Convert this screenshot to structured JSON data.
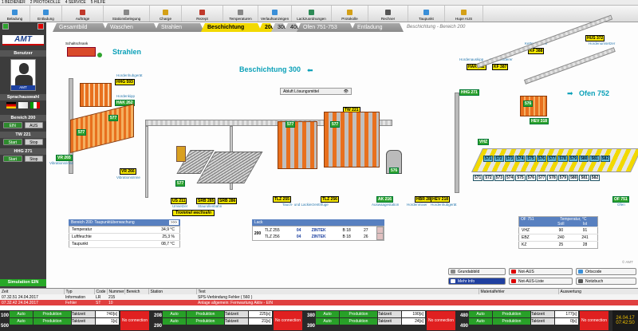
{
  "menu": [
    "1 BEDIENER",
    "2 PROTOKOLLE",
    "4 SERVICE",
    "5 HILFE"
  ],
  "toolbar": {
    "items": [
      "Beladung",
      "Entladung",
      "Aufträge",
      "Stationsbelegung",
      "Charge",
      "Rezept",
      "Temperaturen",
      "Verlaufsanzeigen",
      "Lackzuordnungen",
      "Protokolle",
      "Rechner",
      "Taupunkt",
      "Hupe AUS"
    ],
    "colors": [
      "#3a8fd8",
      "#3a8fd8",
      "#c0392b",
      "#888888",
      "#d4a017",
      "#c0392b",
      "#888888",
      "#3a8fd8",
      "#2e8b57",
      "#d4a017",
      "#555555",
      "#3a8fd8",
      "#d4a017"
    ]
  },
  "sidebar": {
    "logo": "AMT",
    "user_header": "Benutzer",
    "user_badge": "AMT",
    "lang_header": "Sprachauswahl",
    "bereich200": {
      "title": "Bereich 200",
      "ein": "EIN",
      "aus": "AUS"
    },
    "tw221": {
      "title": "TW 221",
      "start": "Start",
      "stop": "Stop"
    },
    "hhg271": {
      "title": "HHG 271",
      "start": "Start",
      "stop": "Stop"
    },
    "simulation": "Simulation EIN"
  },
  "tabs": [
    {
      "label": "Gesamtbild"
    },
    {
      "label": "Waschen"
    },
    {
      "label": "Strahlen"
    },
    {
      "label": "Beschichtung"
    },
    {
      "label": "200"
    },
    {
      "label": "300"
    },
    {
      "label": "400"
    },
    {
      "label": "Ofen 751-753"
    },
    {
      "label": "Entladung"
    },
    {
      "label": "Beschichtung - Bereich 200"
    }
  ],
  "plant": {
    "titles": {
      "strahlen": "Strahlen",
      "beschichtung": "Beschichtung 300",
      "ofen": "Ofen 752"
    },
    "labels": {
      "schaltschrank": "Schaltschrank",
      "hhg593": "HHG 593",
      "hak262": "HAK 262",
      "vr265": "VR 265",
      "vr266": "VR 266",
      "us211": "US 211",
      "srb285": "SRB 285",
      "srb286": "SRB 286",
      "tlz255": "TLZ 255",
      "tlz256": "TLZ 256",
      "tw221": "TW 221",
      "ak216": "AK 216",
      "hbr280": "HBR 280",
      "hev218": "HEV 218",
      "hus372": "HUS 372",
      "kf388": "KF 388",
      "hak362": "HAK 362",
      "kf387": "KF 387",
      "hhg271": "HHG 271",
      "hev318": "HEV 318",
      "of751": "OF 751",
      "vhz": "VHZ",
      "trommel": "Trommel wechseln"
    },
    "captions": {
      "hordenhubgeraet": "Hordenhubgerät",
      "hordenkipp": "Hordenkipp",
      "vibrationsrinne": "Vibrationsrinne",
      "umsetzer": "Umsetzer",
      "staurollenbahn": "Staurollenbahn",
      "tauch": "Tauch- und Lackierzentrifuge",
      "auswaage": "Auswaagestation",
      "hordenmixer": "Hordenmixer",
      "hordenhubgeraet2": "Hordenhubgerät",
      "kettenfoerderer": "Kettenförderer",
      "hordenauskipp": "Hordenauskipp",
      "hordenumsetzer": "Hordenumsetzer",
      "ofen": "Ofen",
      "abluft": "Abluft Lösungsmittel"
    },
    "chips": [
      "571",
      "572",
      "573",
      "574",
      "575",
      "576",
      "577",
      "578",
      "579",
      "580",
      "581",
      "582"
    ]
  },
  "taupunkt": {
    "title": "Bereich 200:",
    "title2": "Taupunktüberwachung",
    "rows": [
      {
        "label": "Temperatur",
        "value": "34,9 °C"
      },
      {
        "label": "Luftfeuchte",
        "value": "25,3 %"
      },
      {
        "label": "Taupunkt",
        "value": "08,7 °C"
      }
    ]
  },
  "lack": {
    "title": "Lack",
    "station": "200",
    "rows": [
      {
        "tlz": "TLZ 255",
        "nr": "04",
        "name": "ZINTEK",
        "kind": "B 18",
        "val": "27"
      },
      {
        "tlz": "TLZ 256",
        "nr": "04",
        "name": "ZINTEK",
        "kind": "B 18",
        "val": "26"
      }
    ]
  },
  "ofen_table": {
    "title": "OF 751",
    "header": "Temperatur, °C",
    "soll": "Soll",
    "ist": "Ist",
    "rows": [
      {
        "zone": "VHZ",
        "soll": "90",
        "ist": "91"
      },
      {
        "zone": "EBZ",
        "soll": "240",
        "ist": "241"
      },
      {
        "zone": "KZ",
        "soll": "25",
        "ist": "28"
      }
    ]
  },
  "buttons": {
    "grundabbild": "Grundabbild",
    "notaus": "Not-AUS",
    "ortscode": "Ortscode",
    "mehrinfo": "Mehr Info",
    "notausliste": "Not-AUS-Liste",
    "notizbuch": "Notizbuch"
  },
  "copyright": "© AMT",
  "alarm": {
    "headers": [
      "Zeit",
      "Typ",
      "Code",
      "Nummer",
      "Bereich",
      "Station",
      "Text",
      "Materialfehler",
      "Auswertung"
    ],
    "rows": [
      {
        "zeit": "07.32.51 24.04.2017",
        "typ": "Information",
        "code": "LR",
        "nummer": "215",
        "bereich": "",
        "station": "",
        "text": "SPS-Verbindung Fehler  ( 560 )"
      },
      {
        "zeit": "07.32.42 24.04.2017",
        "typ": "Fehler",
        "code": "ST",
        "nummer": "10",
        "bereich": "",
        "station": "",
        "text": "Anlage allgemein: Fernwartung Aktiv - EIN"
      }
    ]
  },
  "bottom": [
    {
      "a": "100",
      "b": "500",
      "auto": "Auto",
      "prod": "Produktion",
      "takt": "Taktzeit",
      "v1": "740[s]",
      "v2": "1[s]",
      "nc": "No connection"
    },
    {
      "a": "208",
      "b": "290",
      "auto": "Auto",
      "prod": "Produktion",
      "takt": "Taktzeit",
      "v1": "225[s]",
      "v2": "21[s]",
      "nc": "No connection"
    },
    {
      "a": "380",
      "b": "390",
      "auto": "Auto",
      "prod": "Produktion",
      "takt": "Taktzeit",
      "v1": "190[s]",
      "v2": "24[s]",
      "nc": "No connection"
    },
    {
      "a": "480",
      "b": "490",
      "auto": "Auto",
      "prod": "Produktion",
      "takt": "Taktzeit",
      "v1": "177[s]",
      "v2": "0[s]",
      "nc": "No connection"
    }
  ],
  "clock": {
    "date": "24.04.17",
    "time": "07:42:50"
  }
}
